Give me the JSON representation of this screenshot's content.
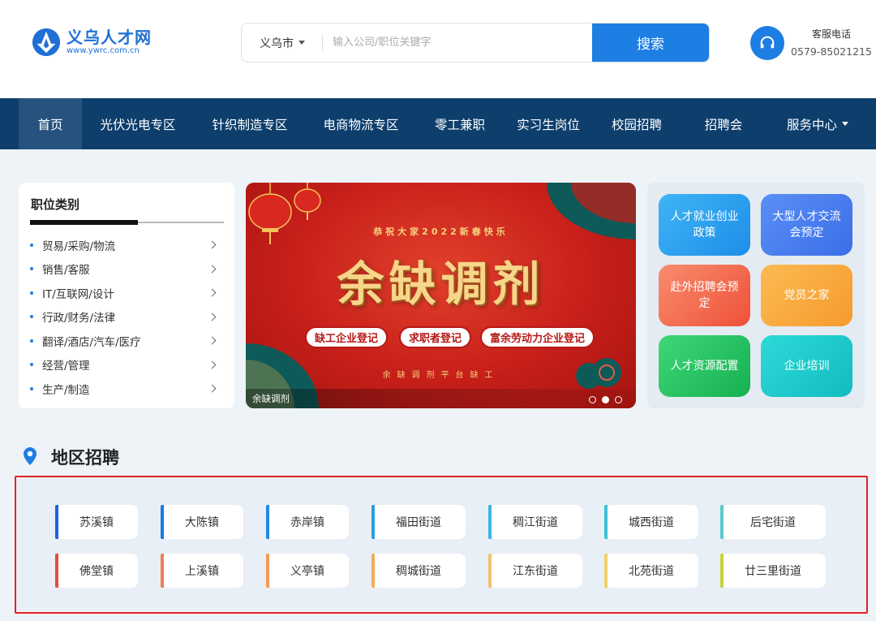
{
  "brand": {
    "name": "义乌人才网",
    "url": "www.ywrc.com.cn",
    "color": "#1f6fd6"
  },
  "search": {
    "city": "义乌市",
    "placeholder": "输入公司/职位关键字",
    "button": "搜索"
  },
  "service": {
    "label": "客服电话",
    "phone": "0579-85021215"
  },
  "nav": {
    "items": [
      {
        "label": "首页",
        "active": true
      },
      {
        "label": "光伏光电专区"
      },
      {
        "label": "针织制造专区"
      },
      {
        "label": "电商物流专区"
      },
      {
        "label": "零工兼职"
      },
      {
        "label": "实习生岗位"
      },
      {
        "label": "校园招聘"
      },
      {
        "label": "招聘会"
      },
      {
        "label": "服务中心",
        "dropdown": true
      }
    ]
  },
  "categories": {
    "title": "职位类别",
    "items": [
      "贸易/采购/物流",
      "销售/客服",
      "IT/互联网/设计",
      "行政/财务/法律",
      "翻译/酒店/汽车/医疗",
      "经营/管理",
      "生产/制造"
    ]
  },
  "banner": {
    "top_text": "恭祝大家2022新春快乐",
    "headline": "余缺调剂",
    "buttons": [
      "缺工企业登记",
      "求职者登记",
      "富余劳动力企业登记"
    ],
    "sub_text": "余缺调剂平台缺工",
    "caption": "余缺调剂",
    "slides": 3,
    "active_slide": 2
  },
  "quick_links": [
    {
      "label": "人才就业创业政策",
      "color": "#2a9cf0"
    },
    {
      "label": "大型人才交流会预定",
      "color": "#3b78ef"
    },
    {
      "label": "赴外招聘会预定",
      "color": "#f2644a"
    },
    {
      "label": "党员之家",
      "color": "#f7a33a"
    },
    {
      "label": "人才资源配置",
      "color": "#1fbf5c"
    },
    {
      "label": "企业培训",
      "color": "#14c3c6"
    }
  ],
  "region": {
    "title": "地区招聘",
    "rows": [
      [
        {
          "name": "苏溪镇",
          "color": "#1c62e8"
        },
        {
          "name": "大陈镇",
          "color": "#1a79e6"
        },
        {
          "name": "赤岸镇",
          "color": "#1e8ae3"
        },
        {
          "name": "福田街道",
          "color": "#2aa0df"
        },
        {
          "name": "稠江街道",
          "color": "#3db3e2"
        },
        {
          "name": "城西街道",
          "color": "#3dc1d6"
        },
        {
          "name": "后宅街道",
          "color": "#5ac9cf"
        }
      ],
      [
        {
          "name": "佛堂镇",
          "color": "#e94a3b"
        },
        {
          "name": "上溪镇",
          "color": "#f07e52"
        },
        {
          "name": "义亭镇",
          "color": "#f29a54"
        },
        {
          "name": "稠城街道",
          "color": "#f3ad5a"
        },
        {
          "name": "江东街道",
          "color": "#f2c26c"
        },
        {
          "name": "北苑街道",
          "color": "#eed165"
        },
        {
          "name": "廿三里街道",
          "color": "#c7d23a"
        }
      ]
    ]
  }
}
